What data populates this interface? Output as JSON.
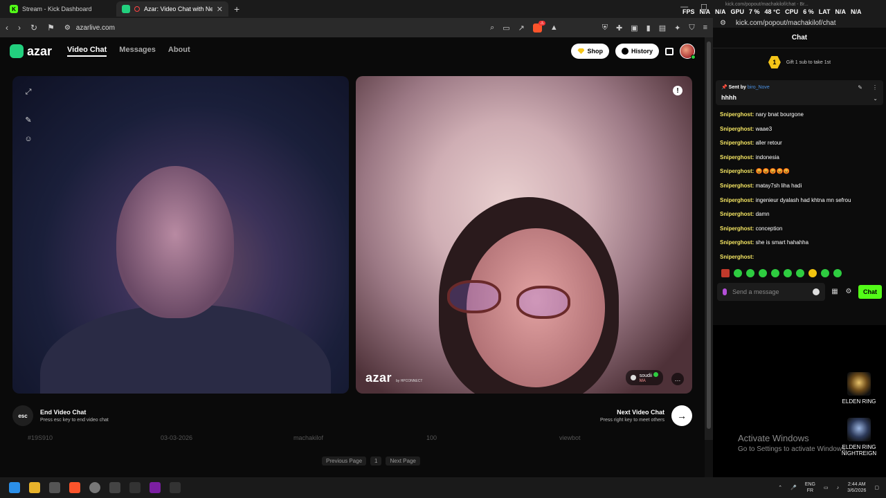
{
  "browser": {
    "tabs": [
      {
        "label": "Stream - Kick Dashboard",
        "icon": "kick-icon"
      },
      {
        "label": "Azar: Video Chat with New Pe",
        "icon": "azar-icon"
      }
    ],
    "url": "azarlive.com"
  },
  "azar": {
    "logo": "azar",
    "nav": [
      "Video Chat",
      "Messages",
      "About"
    ],
    "shop_label": "Shop",
    "history_label": "History",
    "watermark": "azar",
    "watermark_sub": "by HPCONNECT",
    "partner_name": "soudii",
    "partner_country": "MA",
    "end_key": "esc",
    "end_title": "End Video Chat",
    "end_sub": "Press esc key to end video chat",
    "next_title": "Next Video Chat",
    "next_sub": "Press right key to meet others",
    "below_row": [
      "#19S910",
      "03-03-2026",
      "machakilof",
      "100",
      "viewbot"
    ],
    "pager": [
      "Previous Page",
      "1",
      "Next Page"
    ]
  },
  "chat": {
    "url_line": "kick.com/popout/machakilof/chat - Br...",
    "address": "kick.com/popout/machakilof/chat",
    "title": "Chat",
    "gift_text": "Gift 1 sub to take 1st",
    "gift_badge": "1",
    "pinned_label": "Sent by",
    "pinned_user": "biro_Nove",
    "pinned_message": "hhhh",
    "messages": [
      {
        "user": "Sniperghost:",
        "text": "nary bnat bourgone"
      },
      {
        "user": "Sniperghost:",
        "text": "waae3"
      },
      {
        "user": "Sniperghost:",
        "text": "aller retour"
      },
      {
        "user": "Sniperghost:",
        "text": "indonesia"
      },
      {
        "user": "Sniperghost:",
        "text": "😡😡😡😡😡"
      },
      {
        "user": "Sniperghost:",
        "text": "matay7sh liha hadi"
      },
      {
        "user": "Sniperghost:",
        "text": "ingenieur dyalash had khtna mn sefrou"
      },
      {
        "user": "Sniperghost:",
        "text": "damn"
      },
      {
        "user": "Sniperghost:",
        "text": "conception"
      },
      {
        "user": "Sniperghost:",
        "text": "she is smart hahahha"
      },
      {
        "user": "Sniperghost:",
        "text": ""
      }
    ],
    "input_placeholder": "Send a message",
    "send_label": "Chat"
  },
  "overlay": {
    "fps_label": "FPS",
    "fps": "N/A",
    "fps2": "N/A",
    "gpu_label": "GPU",
    "gpu": "7 %",
    "gpu_temp": "48 °C",
    "cpu_label": "CPU",
    "cpu": "6 %",
    "lat_label": "LAT",
    "lat": "N/A",
    "lat2": "N/A"
  },
  "desktop": {
    "activate_title": "Activate Windows",
    "activate_sub": "Go to Settings to activate Windows.",
    "icons": [
      "ELDEN RING",
      "ELDEN RING NIGHTREIGN"
    ]
  },
  "taskbar": {
    "lang1": "ENG",
    "lang2": "FR",
    "time": "2:44 AM",
    "date": "3/6/2026"
  }
}
